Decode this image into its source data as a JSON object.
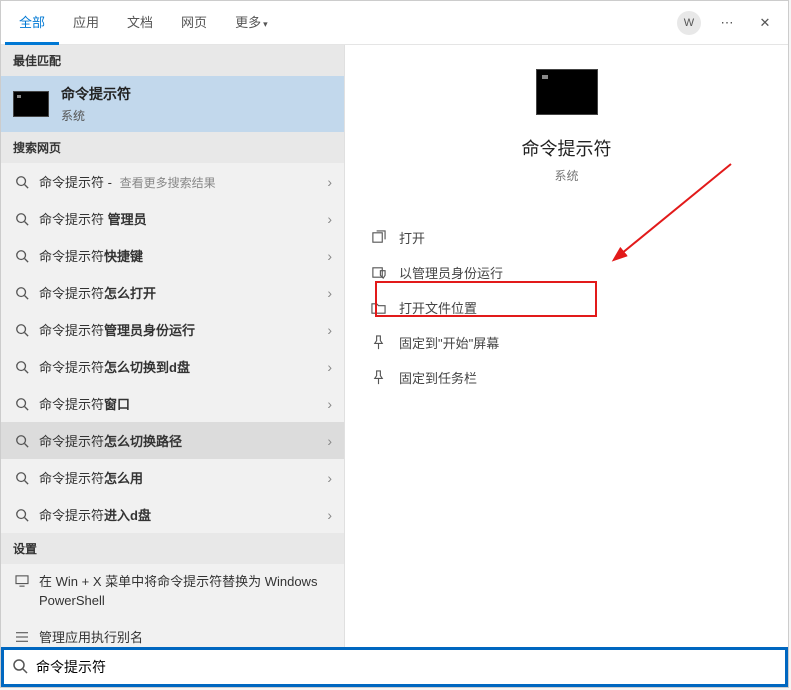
{
  "header": {
    "tabs": [
      "全部",
      "应用",
      "文档",
      "网页",
      "更多"
    ],
    "avatar_letter": "W"
  },
  "left": {
    "best_match_header": "最佳匹配",
    "best_match": {
      "title": "命令提示符",
      "subtitle": "系统"
    },
    "web_header": "搜索网页",
    "web_items": [
      {
        "prefix": "命令提示符",
        "bold": "",
        "suffix": "查看更多搜索结果"
      },
      {
        "prefix": "命令提示符 ",
        "bold": "管理员",
        "suffix": ""
      },
      {
        "prefix": "命令提示符",
        "bold": "快捷键",
        "suffix": ""
      },
      {
        "prefix": "命令提示符",
        "bold": "怎么打开",
        "suffix": ""
      },
      {
        "prefix": "命令提示符",
        "bold": "管理员身份运行",
        "suffix": ""
      },
      {
        "prefix": "命令提示符",
        "bold": "怎么切换到d盘",
        "suffix": ""
      },
      {
        "prefix": "命令提示符",
        "bold": "窗口",
        "suffix": ""
      },
      {
        "prefix": "命令提示符",
        "bold": "怎么切换路径",
        "suffix": "",
        "selected": true
      },
      {
        "prefix": "命令提示符",
        "bold": "怎么用",
        "suffix": ""
      },
      {
        "prefix": "命令提示符",
        "bold": "进入d盘",
        "suffix": ""
      }
    ],
    "settings_header": "设置",
    "settings_items": [
      "在 Win + X 菜单中将命令提示符替换为 Windows PowerShell",
      "管理应用执行别名"
    ]
  },
  "right": {
    "title": "命令提示符",
    "subtitle": "系统",
    "actions": [
      "打开",
      "以管理员身份运行",
      "打开文件位置",
      "固定到\"开始\"屏幕",
      "固定到任务栏"
    ]
  },
  "search_value": "命令提示符"
}
